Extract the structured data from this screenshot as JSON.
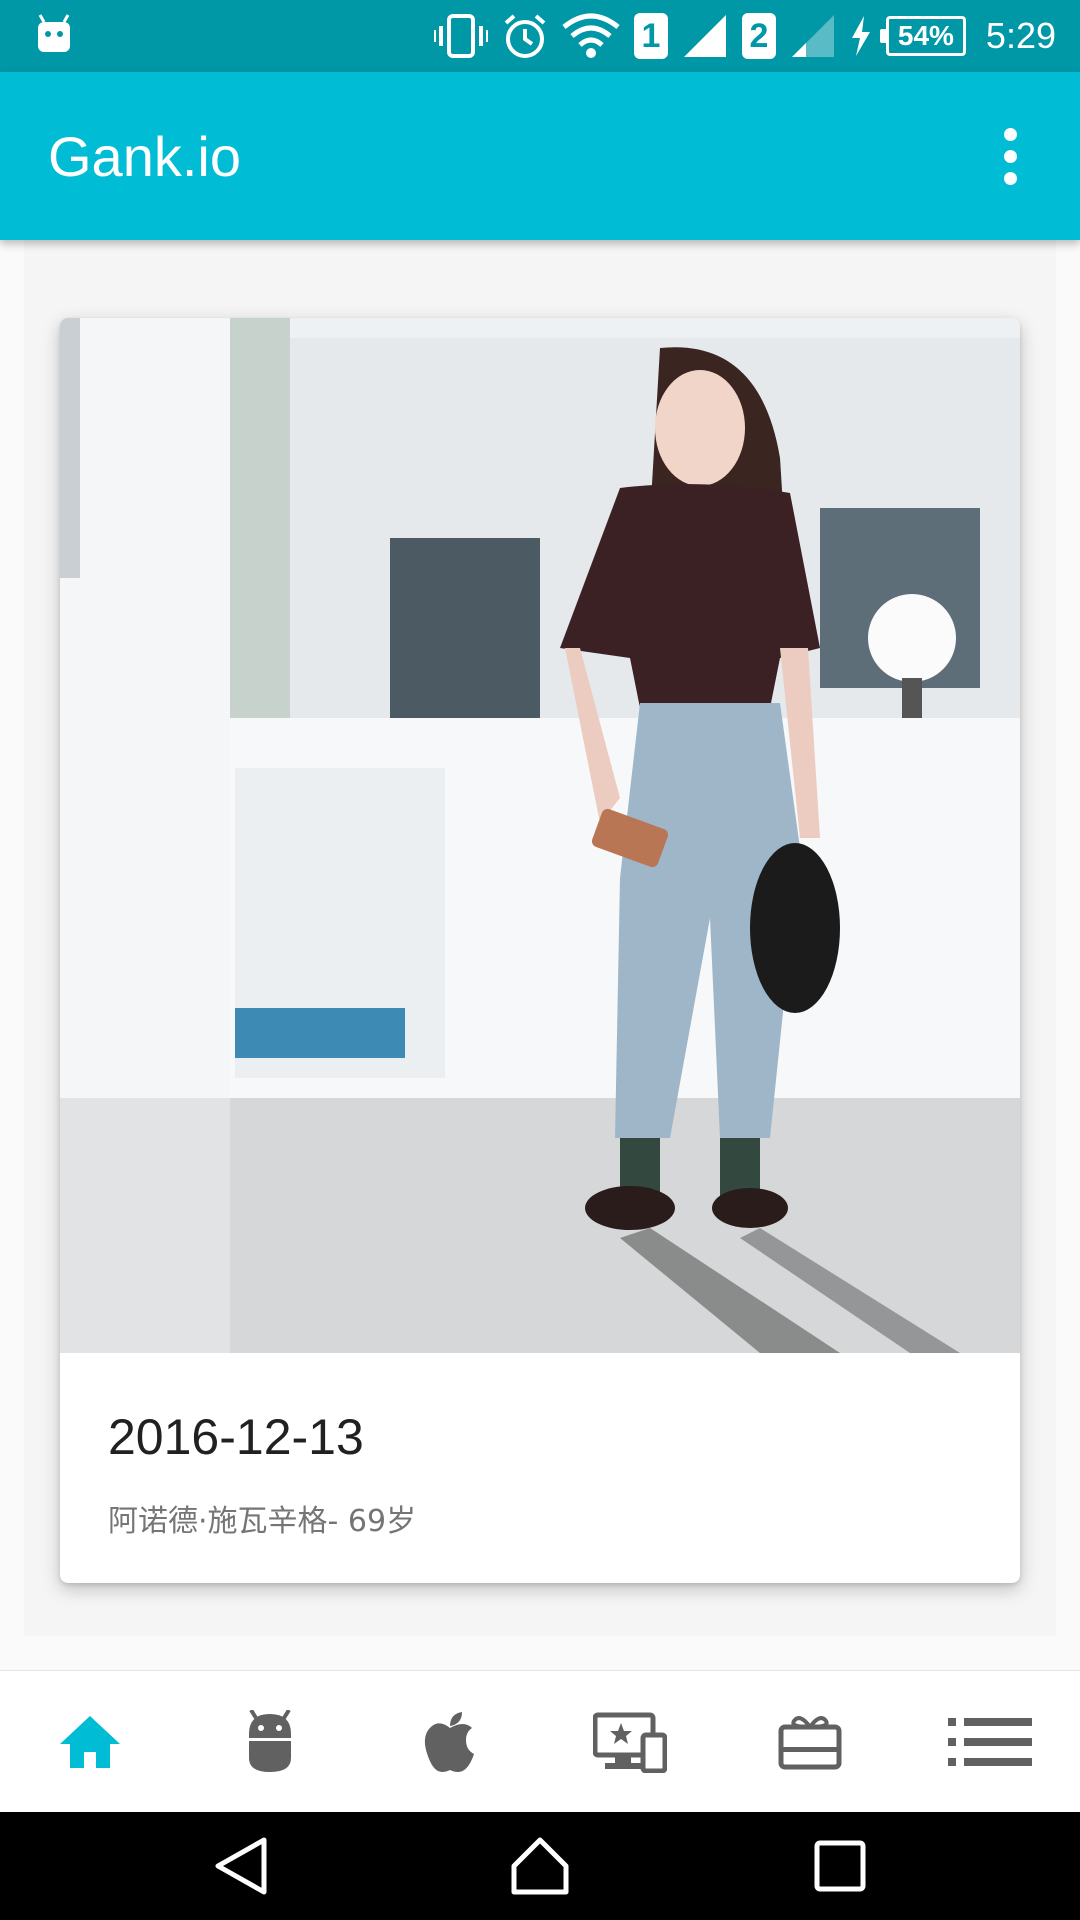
{
  "status_bar": {
    "sim1": "1",
    "sim2": "2",
    "battery": "54%",
    "time": "5:29"
  },
  "app_bar": {
    "title": "Gank.io"
  },
  "card": {
    "date": "2016-12-13",
    "description": "阿诺德·施瓦辛格- 69岁"
  },
  "bottom_nav": {
    "items": [
      {
        "icon": "home-icon",
        "active": true
      },
      {
        "icon": "android-icon",
        "active": false
      },
      {
        "icon": "apple-icon",
        "active": false
      },
      {
        "icon": "devices-star-icon",
        "active": false
      },
      {
        "icon": "gift-card-icon",
        "active": false
      },
      {
        "icon": "list-icon",
        "active": false
      }
    ],
    "active_color": "#00bcd4",
    "inactive_color": "#616161"
  },
  "colors": {
    "status_bar": "#0097a7",
    "app_bar": "#00bcd4"
  }
}
